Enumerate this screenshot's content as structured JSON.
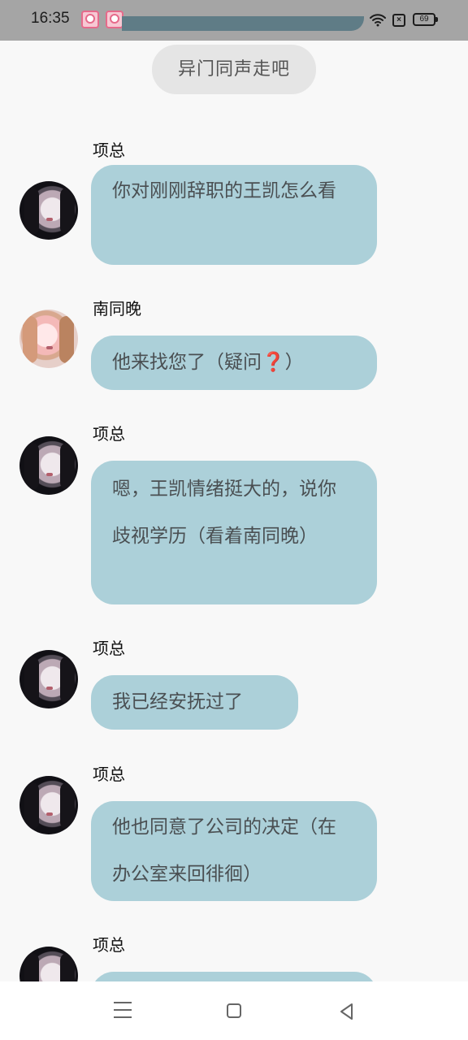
{
  "status_bar": {
    "time": "16:35",
    "icons": [
      "notification-icon",
      "notification-icon",
      "wifi-icon",
      "close-box-icon",
      "battery-icon"
    ],
    "close_box_label": "×",
    "battery_level": "69"
  },
  "chat": {
    "top_button": "异门同声走吧",
    "messages": [
      {
        "sender": "项总",
        "avatar": "dark-hair-avatar",
        "text": "你对刚刚辞职的王凯怎么看"
      },
      {
        "sender": "南同晚",
        "avatar": "pink-hair-avatar",
        "text_prefix": "他来找您了（疑问",
        "emoji": "❓",
        "text_suffix": "）"
      },
      {
        "sender": "项总",
        "avatar": "dark-hair-avatar",
        "text": "嗯，王凯情绪挺大的，说你歧视学历（看着南同晚）"
      },
      {
        "sender": "项总",
        "avatar": "dark-hair-avatar",
        "text": "我已经安抚过了"
      },
      {
        "sender": "项总",
        "avatar": "dark-hair-avatar",
        "text": "他也同意了公司的决定（在办公室来回徘徊）"
      },
      {
        "sender": "项总",
        "avatar": "dark-hair-avatar",
        "text": ""
      }
    ]
  },
  "nav_bar": {
    "icons": [
      "menu-icon",
      "home-icon",
      "back-icon"
    ]
  }
}
